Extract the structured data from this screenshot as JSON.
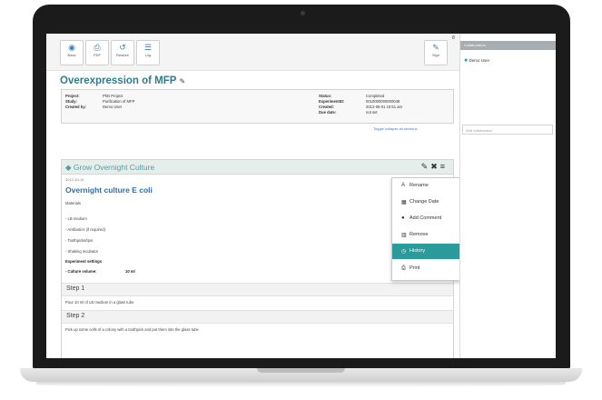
{
  "toolbar": {
    "buttons": [
      {
        "icon": "back-icon",
        "glyph": "◉",
        "label": "Back"
      },
      {
        "icon": "pdf-icon",
        "glyph": "⎙",
        "label": "PDF"
      },
      {
        "icon": "restore-icon",
        "glyph": "↺",
        "label": "Restore"
      },
      {
        "icon": "log-icon",
        "glyph": "☰",
        "label": "Log"
      }
    ],
    "sign": {
      "icon": "sign-icon",
      "glyph": "✎",
      "label": "Sign"
    },
    "badge": "8"
  },
  "experiment": {
    "title": "Overexpression of MFP",
    "title_icon": "✎",
    "project_label": "Project:",
    "project_value": "PhD Project",
    "study_label": "Study:",
    "study_value": "Purification of MFP",
    "created_by_label": "Created by:",
    "created_by_value": "Demo User",
    "status_label": "Status:",
    "status_value": "Completed",
    "experiment_id_label": "ExperimentID:",
    "experiment_id_value": "0010000000000048",
    "created_label": "Created:",
    "created_value": "2012-05-01 10:51 am",
    "due_label": "Due date:",
    "due_value": "not set"
  },
  "toggle_sections": "Toggle collapse all sections",
  "section": {
    "title": "Grow Overnight Culture",
    "date": "2012-10-19",
    "subtitle": "Overnight culture E coli",
    "materials_label": "Materials",
    "materials": [
      "- LB medium",
      "- Antibiotics (if required)",
      "- Toothpicks/tips",
      "- Shaking incubator"
    ],
    "settings_label": "Experiment settings",
    "culture_volume_label": "- Culture volume:",
    "culture_volume_value": "10 ml",
    "step1_label": "Step 1",
    "step1_text": "Pour 10 ml of LB medium in a glass tube",
    "step2_label": "Step 2",
    "step2_text": "Pick up some cells of a colony with a toothpick and put them into the glass tube"
  },
  "menu": {
    "items": [
      {
        "icon": "rename-icon",
        "glyph": "A",
        "label": "Rename"
      },
      {
        "icon": "calendar-icon",
        "glyph": "▦",
        "label": "Change Date"
      },
      {
        "icon": "comment-icon",
        "glyph": "●",
        "label": "Add Comment"
      },
      {
        "icon": "trash-icon",
        "glyph": "▥",
        "label": "Remove"
      },
      {
        "icon": "history-icon",
        "glyph": "◷",
        "label": "History"
      },
      {
        "icon": "print-icon",
        "glyph": "⎙",
        "label": "Print"
      }
    ],
    "active_index": 4
  },
  "collaborators": {
    "header": "Collaborators",
    "users": [
      "Demo User"
    ],
    "add_placeholder": "Add collaborator"
  },
  "colors": {
    "accent": "#2a9a9a",
    "link": "#3a7fc1",
    "title": "#2f7c8a"
  }
}
